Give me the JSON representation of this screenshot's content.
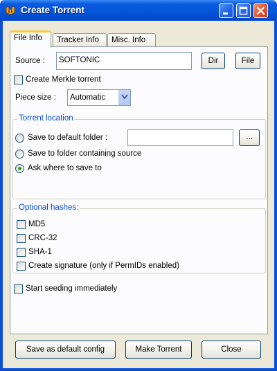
{
  "window": {
    "title": "Create Torrent",
    "colors": {
      "titlebar": "#0554d8",
      "client": "#ece9d8",
      "accent_tab": "#ffc83c",
      "group_title": "#0046d5"
    }
  },
  "tabs": [
    {
      "label": "File Info",
      "active": true
    },
    {
      "label": "Tracker Info",
      "active": false
    },
    {
      "label": "Misc. Info",
      "active": false
    }
  ],
  "file_info": {
    "source_label": "Source :",
    "source_value": "SOFTONIC",
    "dir_button": "Dir",
    "file_button": "File",
    "merkle_label": "Create Merkle torrent",
    "merkle_checked": false,
    "piece_size_label": "Piece size :",
    "piece_size_value": "Automatic"
  },
  "torrent_location": {
    "title": "Torrent location",
    "option_default": "Save to default folder :",
    "option_source": "Save to folder containing source",
    "option_ask": "Ask where to save to",
    "selected": "ask",
    "default_folder_value": "",
    "browse_button": "..."
  },
  "optional_hashes": {
    "title": "Optional hashes:",
    "items": [
      {
        "label": "MD5",
        "checked": false
      },
      {
        "label": "CRC-32",
        "checked": false
      },
      {
        "label": "SHA-1",
        "checked": false
      },
      {
        "label": "Create signature (only if PermIDs enabled)",
        "checked": false
      }
    ]
  },
  "start_seeding": {
    "label": "Start seeding immediately",
    "checked": false
  },
  "footer": {
    "save_default": "Save as default config",
    "make_torrent": "Make Torrent",
    "close": "Close"
  },
  "icons": {
    "app": "torrent-app-icon",
    "minimize": "minimize-icon",
    "maximize": "maximize-icon",
    "close": "close-icon",
    "dropdown": "chevron-down-icon"
  }
}
